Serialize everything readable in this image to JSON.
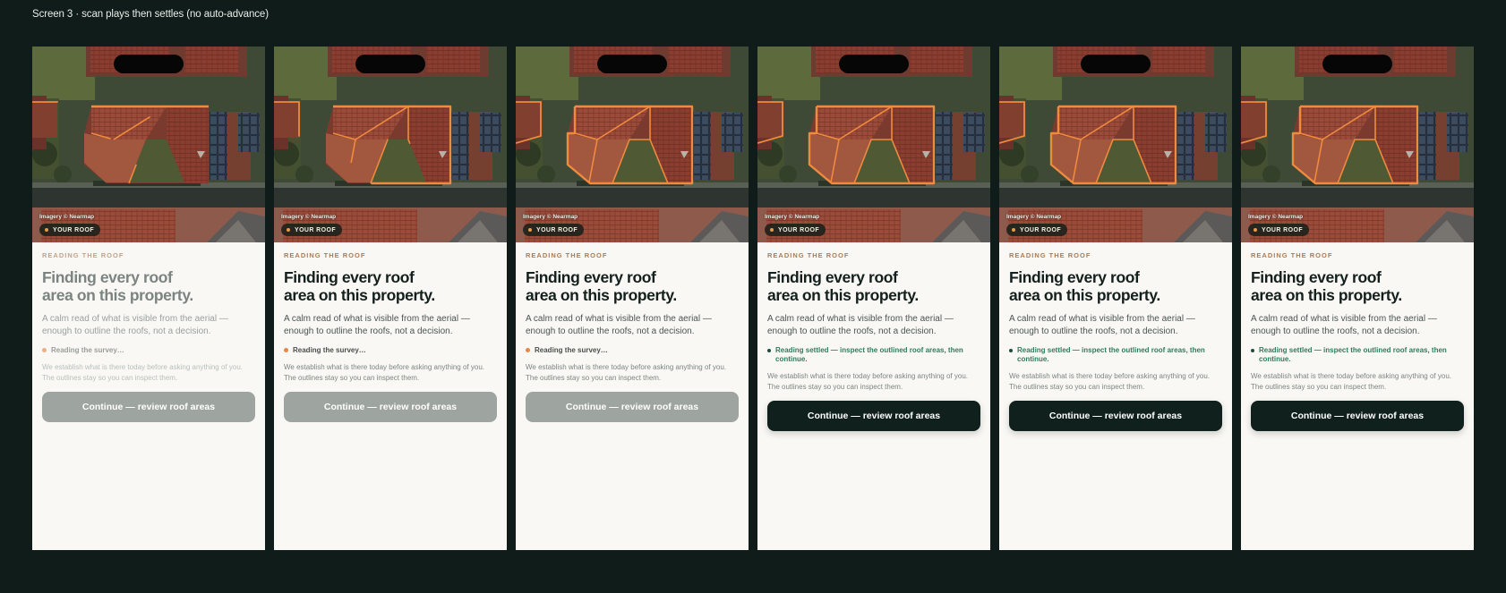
{
  "page_caption": "Screen 3 · scan plays then settles (no auto-advance)",
  "screen": {
    "imagery_credit": "Imagery © Nearmap",
    "roof_badge": "YOUR ROOF",
    "eyebrow": "READING THE ROOF",
    "title_line1": "Finding every roof",
    "title_line2": "area on this property.",
    "lead_line1": "A calm read of what is visible from the aerial —",
    "lead_line2": "enough to outline the roofs, not a decision.",
    "status_reading": "Reading the survey…",
    "status_settled": "Reading settled — inspect the outlined roof areas, then continue.",
    "note_line1": "We establish what is there today before asking anything of you.",
    "note_line2": "The outlines stay so you can inspect them.",
    "cta_label": "Continue — review roof areas"
  },
  "frames": [
    {
      "state": "reading",
      "outline_progress": 0.3
    },
    {
      "state": "reading",
      "outline_progress": 0.7
    },
    {
      "state": "reading",
      "outline_progress": 1.0
    },
    {
      "state": "settled",
      "outline_progress": 1.0
    },
    {
      "state": "settled",
      "outline_progress": 1.0
    },
    {
      "state": "settled",
      "outline_progress": 1.0
    }
  ],
  "colors": {
    "backdrop": "#101c19",
    "outline": "#f08a3e",
    "accent_orange": "#e8874a",
    "settled_green": "#2f7c5f",
    "cta_active": "#10201c"
  },
  "icons": [
    "island-notch",
    "status-dot",
    "badge-dot"
  ]
}
